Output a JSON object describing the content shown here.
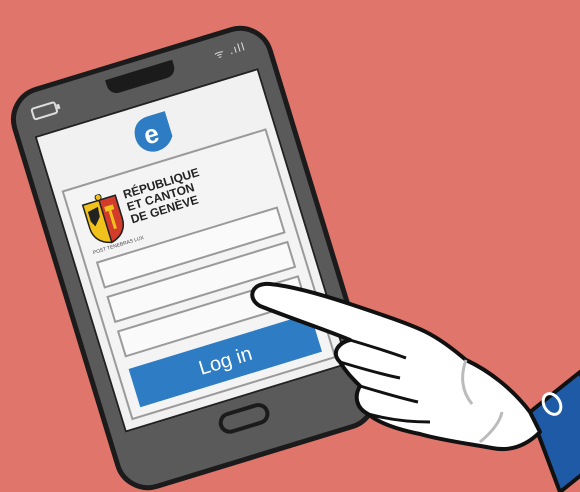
{
  "status_bar": {
    "signal_text": "ᯤ .ıll"
  },
  "app_logo": {
    "letter": "e",
    "color": "#2d7cc4"
  },
  "government": {
    "title": "RÉPUBLIQUE\nET CANTON\nDE GENÈVE",
    "crest_caption": "POST TENEBRAS LUX"
  },
  "login_form": {
    "username_placeholder": "",
    "password_placeholder": "",
    "third_field_placeholder": "",
    "login_label": "Log in",
    "button_color": "#2d7cc4"
  },
  "colors": {
    "background": "#E0756B",
    "phone_body": "#5a5a5a",
    "wristband": "#1e5aa6"
  },
  "icons": {
    "battery": "battery-icon",
    "wifi": "wifi-icon",
    "signal": "signal-icon",
    "hand": "pointing-hand-icon",
    "home": "home-button-icon"
  }
}
